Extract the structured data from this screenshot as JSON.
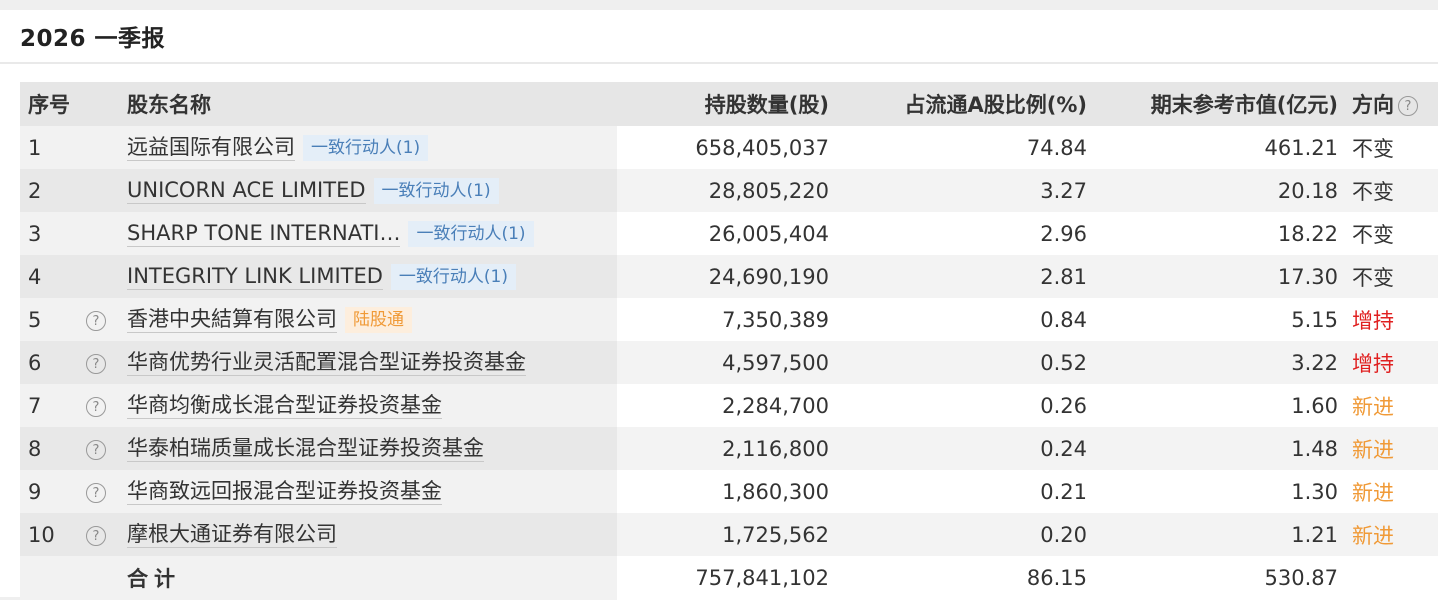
{
  "panel": {
    "title": "2026 一季报"
  },
  "headers": {
    "idx": "序号",
    "name": "股东名称",
    "shares": "持股数量(股)",
    "pct": "占流通A股比例(%)",
    "value": "期末参考市值(亿元)",
    "direction": "方向"
  },
  "help_glyph": "?",
  "rows": [
    {
      "idx": "1",
      "name": "远益国际有限公司",
      "tag": "一致行动人(1)",
      "tag_color": "blue",
      "help": false,
      "shares": "658,405,037",
      "pct": "74.84",
      "value": "461.21",
      "direction": "不变",
      "dir_type": "keep"
    },
    {
      "idx": "2",
      "name": "UNICORN ACE LIMITED",
      "tag": "一致行动人(1)",
      "tag_color": "blue",
      "help": false,
      "shares": "28,805,220",
      "pct": "3.27",
      "value": "20.18",
      "direction": "不变",
      "dir_type": "keep"
    },
    {
      "idx": "3",
      "name": "SHARP TONE INTERNATI…",
      "tag": "一致行动人(1)",
      "tag_color": "blue",
      "help": false,
      "shares": "26,005,404",
      "pct": "2.96",
      "value": "18.22",
      "direction": "不变",
      "dir_type": "keep"
    },
    {
      "idx": "4",
      "name": "INTEGRITY LINK LIMITED",
      "tag": "一致行动人(1)",
      "tag_color": "blue",
      "help": false,
      "shares": "24,690,190",
      "pct": "2.81",
      "value": "17.30",
      "direction": "不变",
      "dir_type": "keep"
    },
    {
      "idx": "5",
      "name": "香港中央結算有限公司",
      "tag": "陆股通",
      "tag_color": "orange",
      "help": true,
      "shares": "7,350,389",
      "pct": "0.84",
      "value": "5.15",
      "direction": "增持",
      "dir_type": "up"
    },
    {
      "idx": "6",
      "name": "华商优势行业灵活配置混合型证券投资基金",
      "tag": "",
      "tag_color": "",
      "help": true,
      "shares": "4,597,500",
      "pct": "0.52",
      "value": "3.22",
      "direction": "增持",
      "dir_type": "up"
    },
    {
      "idx": "7",
      "name": "华商均衡成长混合型证券投资基金",
      "tag": "",
      "tag_color": "",
      "help": true,
      "shares": "2,284,700",
      "pct": "0.26",
      "value": "1.60",
      "direction": "新进",
      "dir_type": "new"
    },
    {
      "idx": "8",
      "name": "华泰柏瑞质量成长混合型证券投资基金",
      "tag": "",
      "tag_color": "",
      "help": true,
      "shares": "2,116,800",
      "pct": "0.24",
      "value": "1.48",
      "direction": "新进",
      "dir_type": "new"
    },
    {
      "idx": "9",
      "name": "华商致远回报混合型证券投资基金",
      "tag": "",
      "tag_color": "",
      "help": true,
      "shares": "1,860,300",
      "pct": "0.21",
      "value": "1.30",
      "direction": "新进",
      "dir_type": "new"
    },
    {
      "idx": "10",
      "name": "摩根大通证券有限公司",
      "tag": "",
      "tag_color": "",
      "help": true,
      "shares": "1,725,562",
      "pct": "0.20",
      "value": "1.21",
      "direction": "新进",
      "dir_type": "new"
    }
  ],
  "total": {
    "label": "合计",
    "shares": "757,841,102",
    "pct": "86.15",
    "value": "530.87"
  },
  "colors": {
    "up": "#e02020",
    "new": "#f09a37",
    "tag_blue": "#4a7fb8",
    "tag_orange": "#f09a37"
  }
}
